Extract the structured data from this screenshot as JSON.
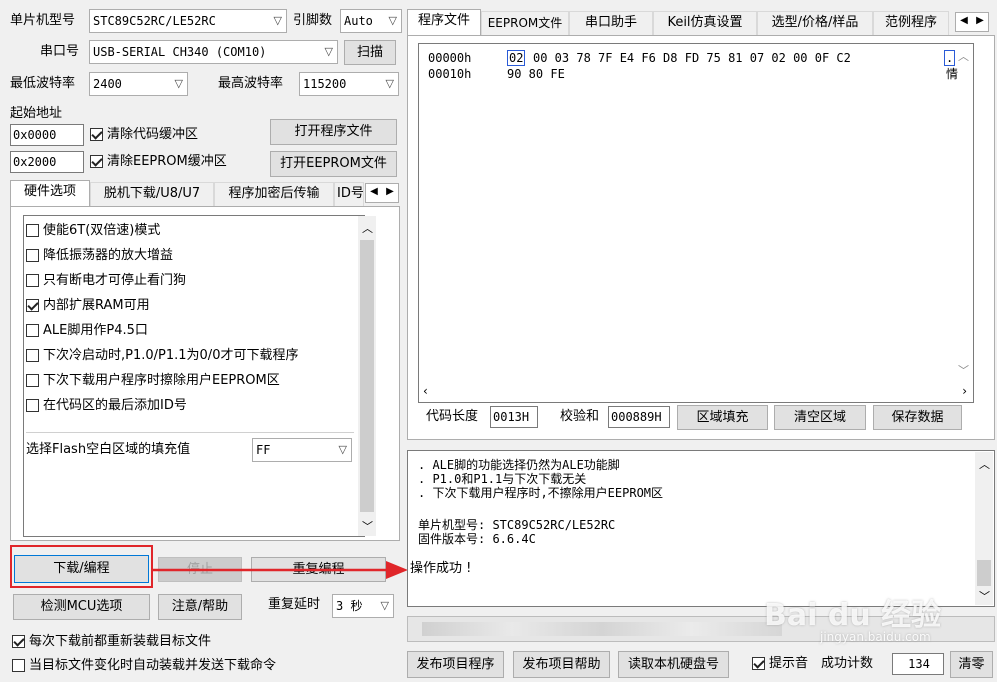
{
  "top": {
    "mcu_label": "单片机型号",
    "mcu_value": "STC89C52RC/LE52RC",
    "pins_label": "引脚数",
    "pins_value": "Auto",
    "port_label": "串口号",
    "port_value": "USB-SERIAL CH340 (COM10)",
    "scan_button": "扫描",
    "min_baud_label": "最低波特率",
    "min_baud_value": "2400",
    "max_baud_label": "最高波特率",
    "max_baud_value": "115200",
    "start_addr_label": "起始地址",
    "addr1_value": "0x0000",
    "clear_code_label": "清除代码缓冲区",
    "open_program_button": "打开程序文件",
    "addr2_value": "0x2000",
    "clear_eeprom_label": "清除EEPROM缓冲区",
    "open_eeprom_button": "打开EEPROM文件"
  },
  "left_tabs": [
    "硬件选项",
    "脱机下载/U8/U7",
    "程序加密后传输",
    "ID号"
  ],
  "options": [
    {
      "label": "使能6T(双倍速)模式",
      "checked": false
    },
    {
      "label": "降低振荡器的放大增益",
      "checked": false
    },
    {
      "label": "只有断电才可停止看门狗",
      "checked": false
    },
    {
      "label": "内部扩展RAM可用",
      "checked": true
    },
    {
      "label": "ALE脚用作P4.5口",
      "checked": false
    },
    {
      "label": "下次冷启动时,P1.0/P1.1为0/0才可下载程序",
      "checked": false
    },
    {
      "label": "下次下载用户程序时擦除用户EEPROM区",
      "checked": false
    },
    {
      "label": "在代码区的最后添加ID号",
      "checked": false
    }
  ],
  "fill": {
    "label": "选择Flash空白区域的填充值",
    "value": "FF"
  },
  "actions": {
    "download_button": "下载/编程",
    "stop_button": "停止",
    "reprogram_button": "重复编程",
    "detect_button": "检测MCU选项",
    "help_button": "注意/帮助",
    "delay_label": "重复延时",
    "delay_value": "3 秒",
    "reload_label": "每次下载前都重新装载目标文件",
    "reload_checked": true,
    "auto_label": "当目标文件变化时自动装载并发送下载命令",
    "auto_checked": false
  },
  "right_tabs": [
    "程序文件",
    "EEPROM文件",
    "串口助手",
    "Keil仿真设置",
    "选型/价格/样品",
    "范例程序"
  ],
  "hex": {
    "rows": [
      {
        "addr": "00000h",
        "first": "02",
        "rest": "00 03 78 7F E4 F6 D8 FD 75 81 07 02 00 0F C2",
        "ascii": "."
      },
      {
        "addr": "00010h",
        "first": "",
        "rest": "90 80 FE",
        "ascii": "情"
      }
    ]
  },
  "code_info": {
    "length_label": "代码长度",
    "length_value": "0013H",
    "checksum_label": "校验和",
    "checksum_value": "000889H",
    "fill_button": "区域填充",
    "clear_button": "清空区域",
    "save_button": "保存数据"
  },
  "log": {
    "lines": [
      ". ALE脚的功能选择仍然为ALE功能脚",
      ". P1.0和P1.1与下次下载无关",
      ". 下次下载用户程序时,不擦除用户EEPROM区",
      "",
      "单片机型号: STC89C52RC/LE52RC",
      "固件版本号: 6.6.4C"
    ],
    "result": "操作成功 !"
  },
  "bottom": {
    "publish_button": "发布项目程序",
    "publish_help_button": "发布项目帮助",
    "read_disk_button": "读取本机硬盘号",
    "prompt_label": "提示音",
    "prompt_checked": true,
    "count_label": "成功计数",
    "count_value": "134",
    "reset_button": "清零"
  },
  "watermark": {
    "brand": "Bai du 经验",
    "url": "jingyan.baidu.com"
  },
  "colors": {
    "highlight_red": "#e0262a",
    "selection_blue": "#2a5bd7",
    "window_bg": "#f0f0f0"
  }
}
